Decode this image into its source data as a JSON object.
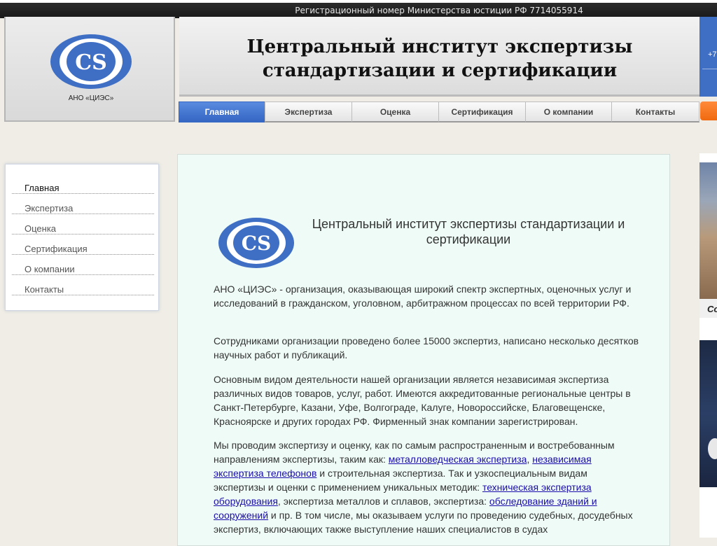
{
  "topbar": {
    "registration_text": "Регистрационный номер Министерства юстиции РФ 7714055914"
  },
  "logo": {
    "letters": "CS",
    "caption": "АНО «ЦИЭС»",
    "color": "#3f6fc4"
  },
  "header": {
    "title_line1": "Центральный институт экспертизы",
    "title_line2": "стандартизации и сертификации",
    "phone_fragment": "+7"
  },
  "nav": {
    "items": [
      {
        "label": "Главная",
        "active": true
      },
      {
        "label": "Экспертиза"
      },
      {
        "label": "Оценка"
      },
      {
        "label": "Сертификация"
      },
      {
        "label": "О компании"
      },
      {
        "label": "Контакты"
      }
    ]
  },
  "sidebar": {
    "items": [
      {
        "label": "Главная",
        "active": true
      },
      {
        "label": "Экспертиза"
      },
      {
        "label": "Оценка"
      },
      {
        "label": "Сертификация"
      },
      {
        "label": "О компании"
      },
      {
        "label": "Контакты"
      }
    ]
  },
  "content": {
    "title": "Центральный институт экспертизы стандартизации и сертификации",
    "p1": " АНО «ЦИЭС» - организация, оказывающая широкий спектр экспертных, оценочных услуг и исследований в гражданском, уголовном, арбитражном процессах по всей территории РФ.",
    "p2": " Сотрудниками организации проведено более 15000 экспертиз, написано несколько десятков научных работ и публикаций.",
    "p3": " Основным видом деятельности нашей организации является независимая экспертиза различных видов товаров, услуг, работ. Имеются аккредитованные региональные центры в Санкт-Петербурге, Казани, Уфе, Волгограде, Калуге, Новороссийске, Благовещенске, Красноярске и других городах РФ. Фирменный знак компании зарегистрирован.",
    "p4": {
      "t1": " Мы проводим экспертизу и оценку, как по самым распространенным и востребованным направлениям экспертизы, таким как: ",
      "link1": "металловедческая экспертиза",
      "t2": ", ",
      "link2": "независимая экспертиза телефонов",
      "t3": " и строительная экспертиза. Так и узкоспециальным видам экспертизы и оценки с применением уникальных методик: ",
      "link3": "техническая экспертиза оборудования",
      "t4": ", экспертиза металлов и сплавов, экспертиза: ",
      "link4": "обследование зданий и сооружений",
      "t5": " и пр. В том числе, мы оказываем услуги по проведению судебных, досудебных экспертиз, включающих также выступление наших специалистов в судах"
    }
  },
  "right_strip": {
    "caption_fragment": "Со"
  }
}
